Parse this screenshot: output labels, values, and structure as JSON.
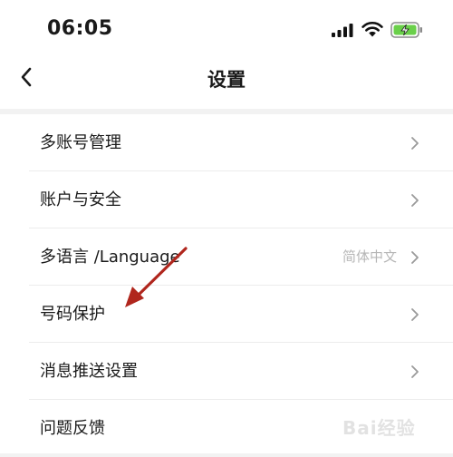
{
  "status_bar": {
    "time": "06:05",
    "icons": [
      "cellular-signal-icon",
      "wifi-icon",
      "battery-charging-icon"
    ]
  },
  "nav": {
    "title": "设置",
    "back_icon": "chevron-left-icon"
  },
  "settings": {
    "items": [
      {
        "label": "多账号管理",
        "value": ""
      },
      {
        "label": "账户与安全",
        "value": ""
      },
      {
        "label": "多语言 /Language",
        "value": "简体中文"
      },
      {
        "label": "号码保护",
        "value": ""
      },
      {
        "label": "消息推送设置",
        "value": ""
      },
      {
        "label": "问题反馈",
        "value": ""
      }
    ]
  },
  "annotation": {
    "color": "#b0261d",
    "target": "号码保护"
  },
  "watermark": {
    "text": "Bai经验"
  },
  "colors": {
    "battery_fill": "#6ad04a",
    "chevron": "#9a9a9a",
    "value_text": "#b6b6b6"
  }
}
